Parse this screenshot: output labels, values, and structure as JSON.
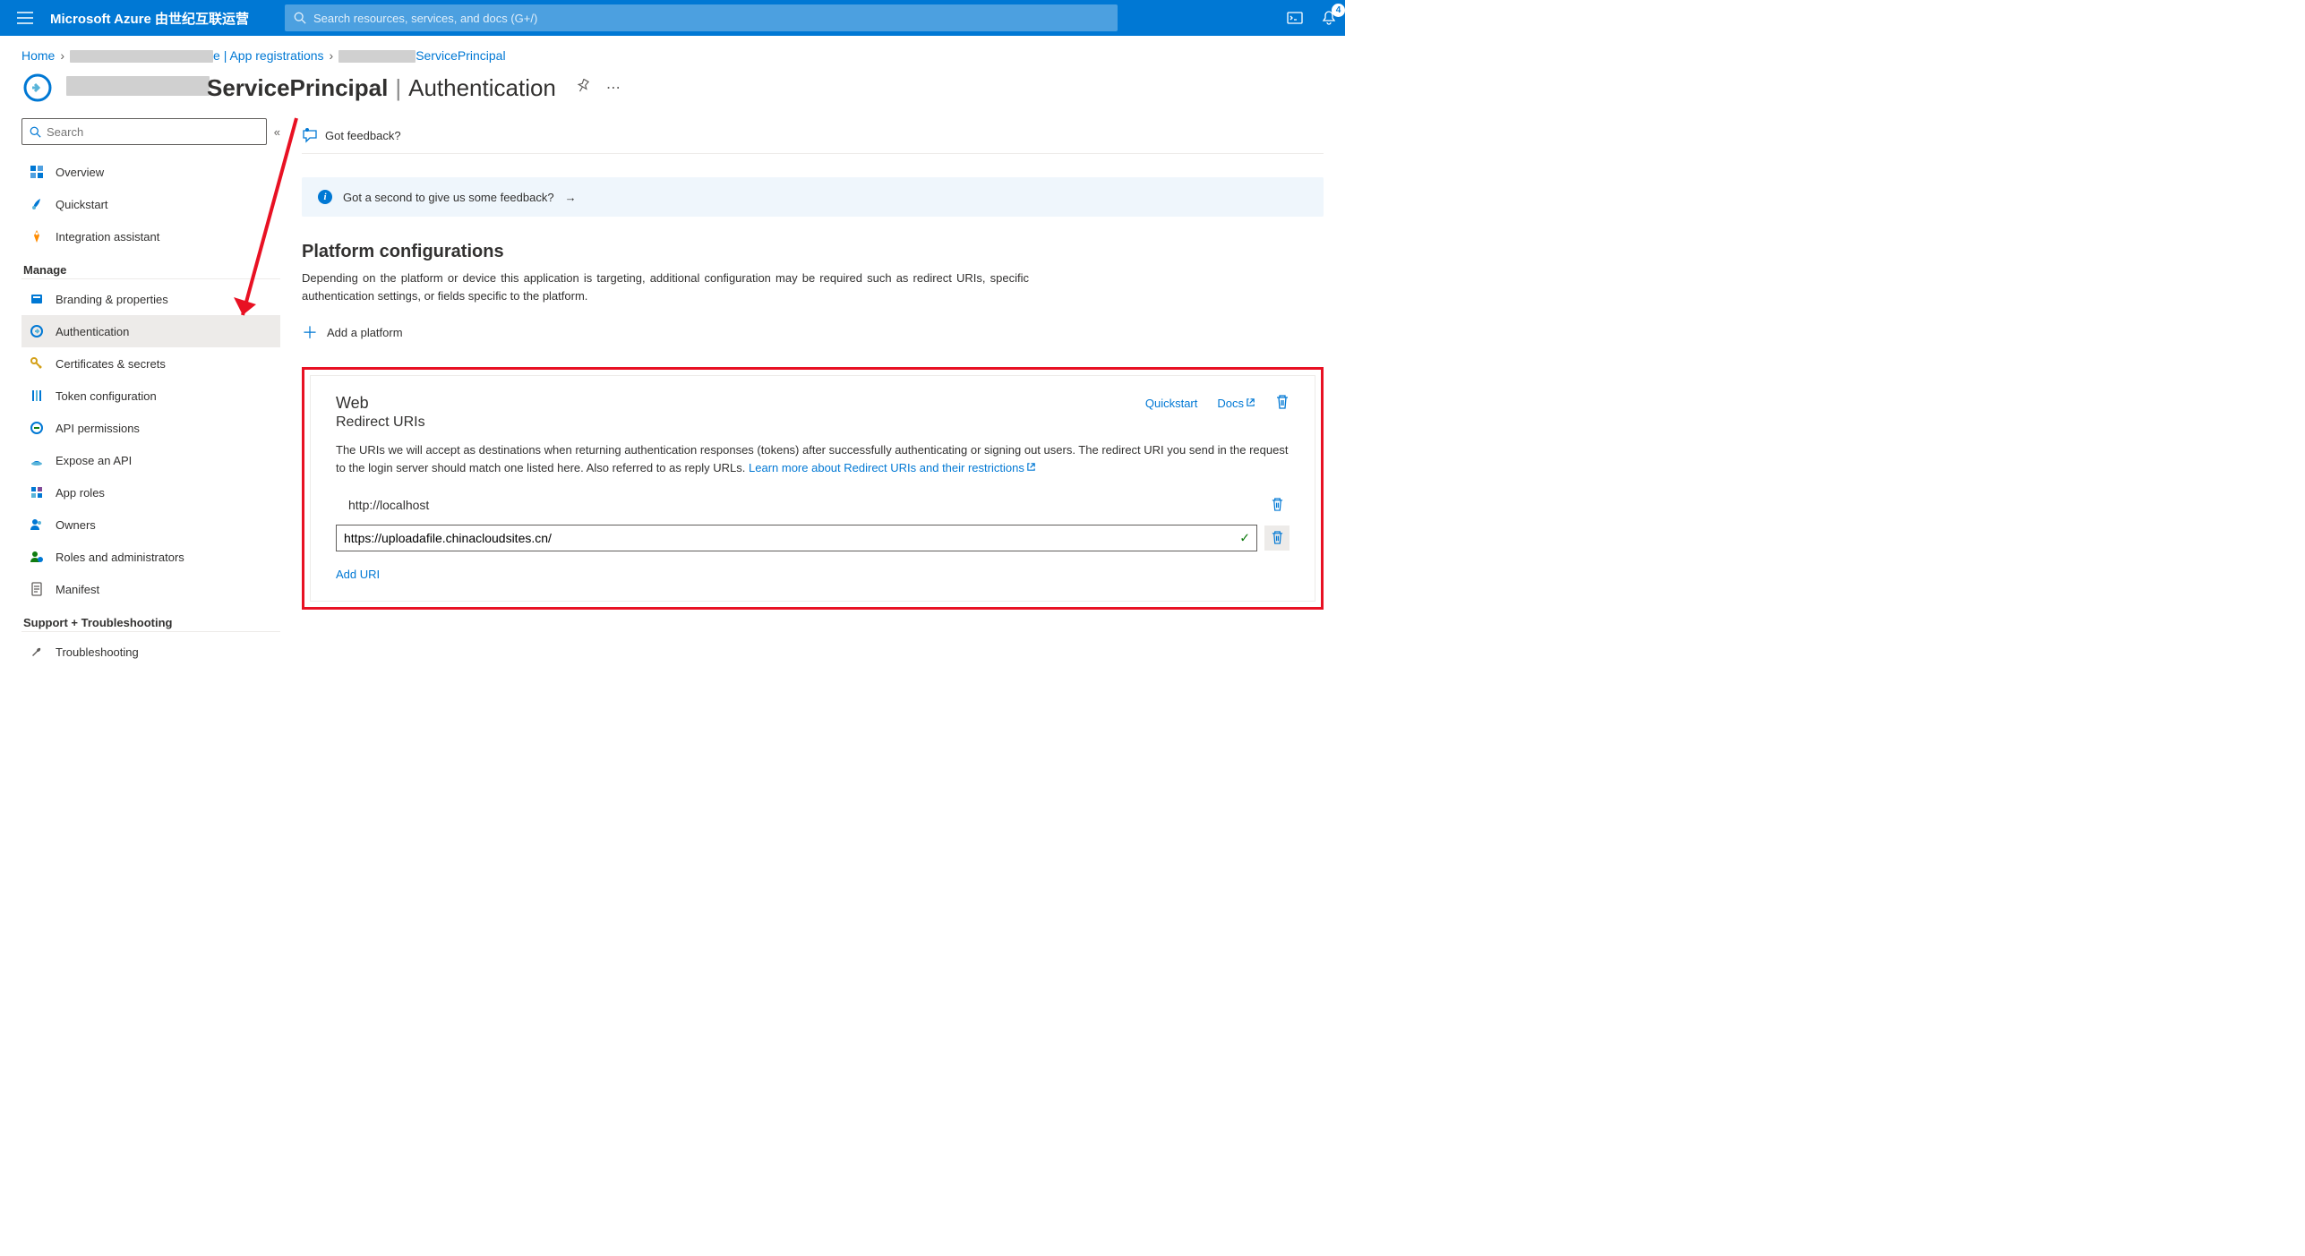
{
  "topbar": {
    "brand": "Microsoft Azure 由世纪互联运营",
    "search_placeholder": "Search resources, services, and docs (G+/)",
    "notification_count": "4"
  },
  "breadcrumb": {
    "home": "Home",
    "part2_suffix": "e | App registrations",
    "part3_suffix": "ServicePrincipal"
  },
  "page_header": {
    "title_suffix": "ServicePrincipal",
    "subtitle": "Authentication"
  },
  "sidebar": {
    "search_placeholder": "Search",
    "items": {
      "overview": "Overview",
      "quickstart": "Quickstart",
      "integration": "Integration assistant"
    },
    "manage_header": "Manage",
    "manage": {
      "branding": "Branding & properties",
      "authentication": "Authentication",
      "certificates": "Certificates & secrets",
      "token": "Token configuration",
      "api_permissions": "API permissions",
      "expose_api": "Expose an API",
      "app_roles": "App roles",
      "owners": "Owners",
      "roles_admins": "Roles and administrators",
      "manifest": "Manifest"
    },
    "support_header": "Support + Troubleshooting",
    "support": {
      "troubleshooting": "Troubleshooting"
    }
  },
  "main": {
    "feedback_label": "Got feedback?",
    "banner_text": "Got a second to give us some feedback?",
    "section_title": "Platform configurations",
    "section_desc": "Depending on the platform or device this application is targeting, additional configuration may be required such as redirect URIs, specific authentication settings, or fields specific to the platform.",
    "add_platform": "Add a platform",
    "platform": {
      "title": "Web",
      "subtitle": "Redirect URIs",
      "quickstart": "Quickstart",
      "docs": "Docs",
      "desc_pre": "The URIs we will accept as destinations when returning authentication responses (tokens) after successfully authenticating or signing out users. The redirect URI you send in the request to the login server should match one listed here. Also referred to as reply URLs. ",
      "desc_link": "Learn more about Redirect URIs and their restrictions",
      "uri1": "http://localhost",
      "uri2": "https://uploadafile.chinacloudsites.cn/",
      "add_uri": "Add URI"
    }
  }
}
